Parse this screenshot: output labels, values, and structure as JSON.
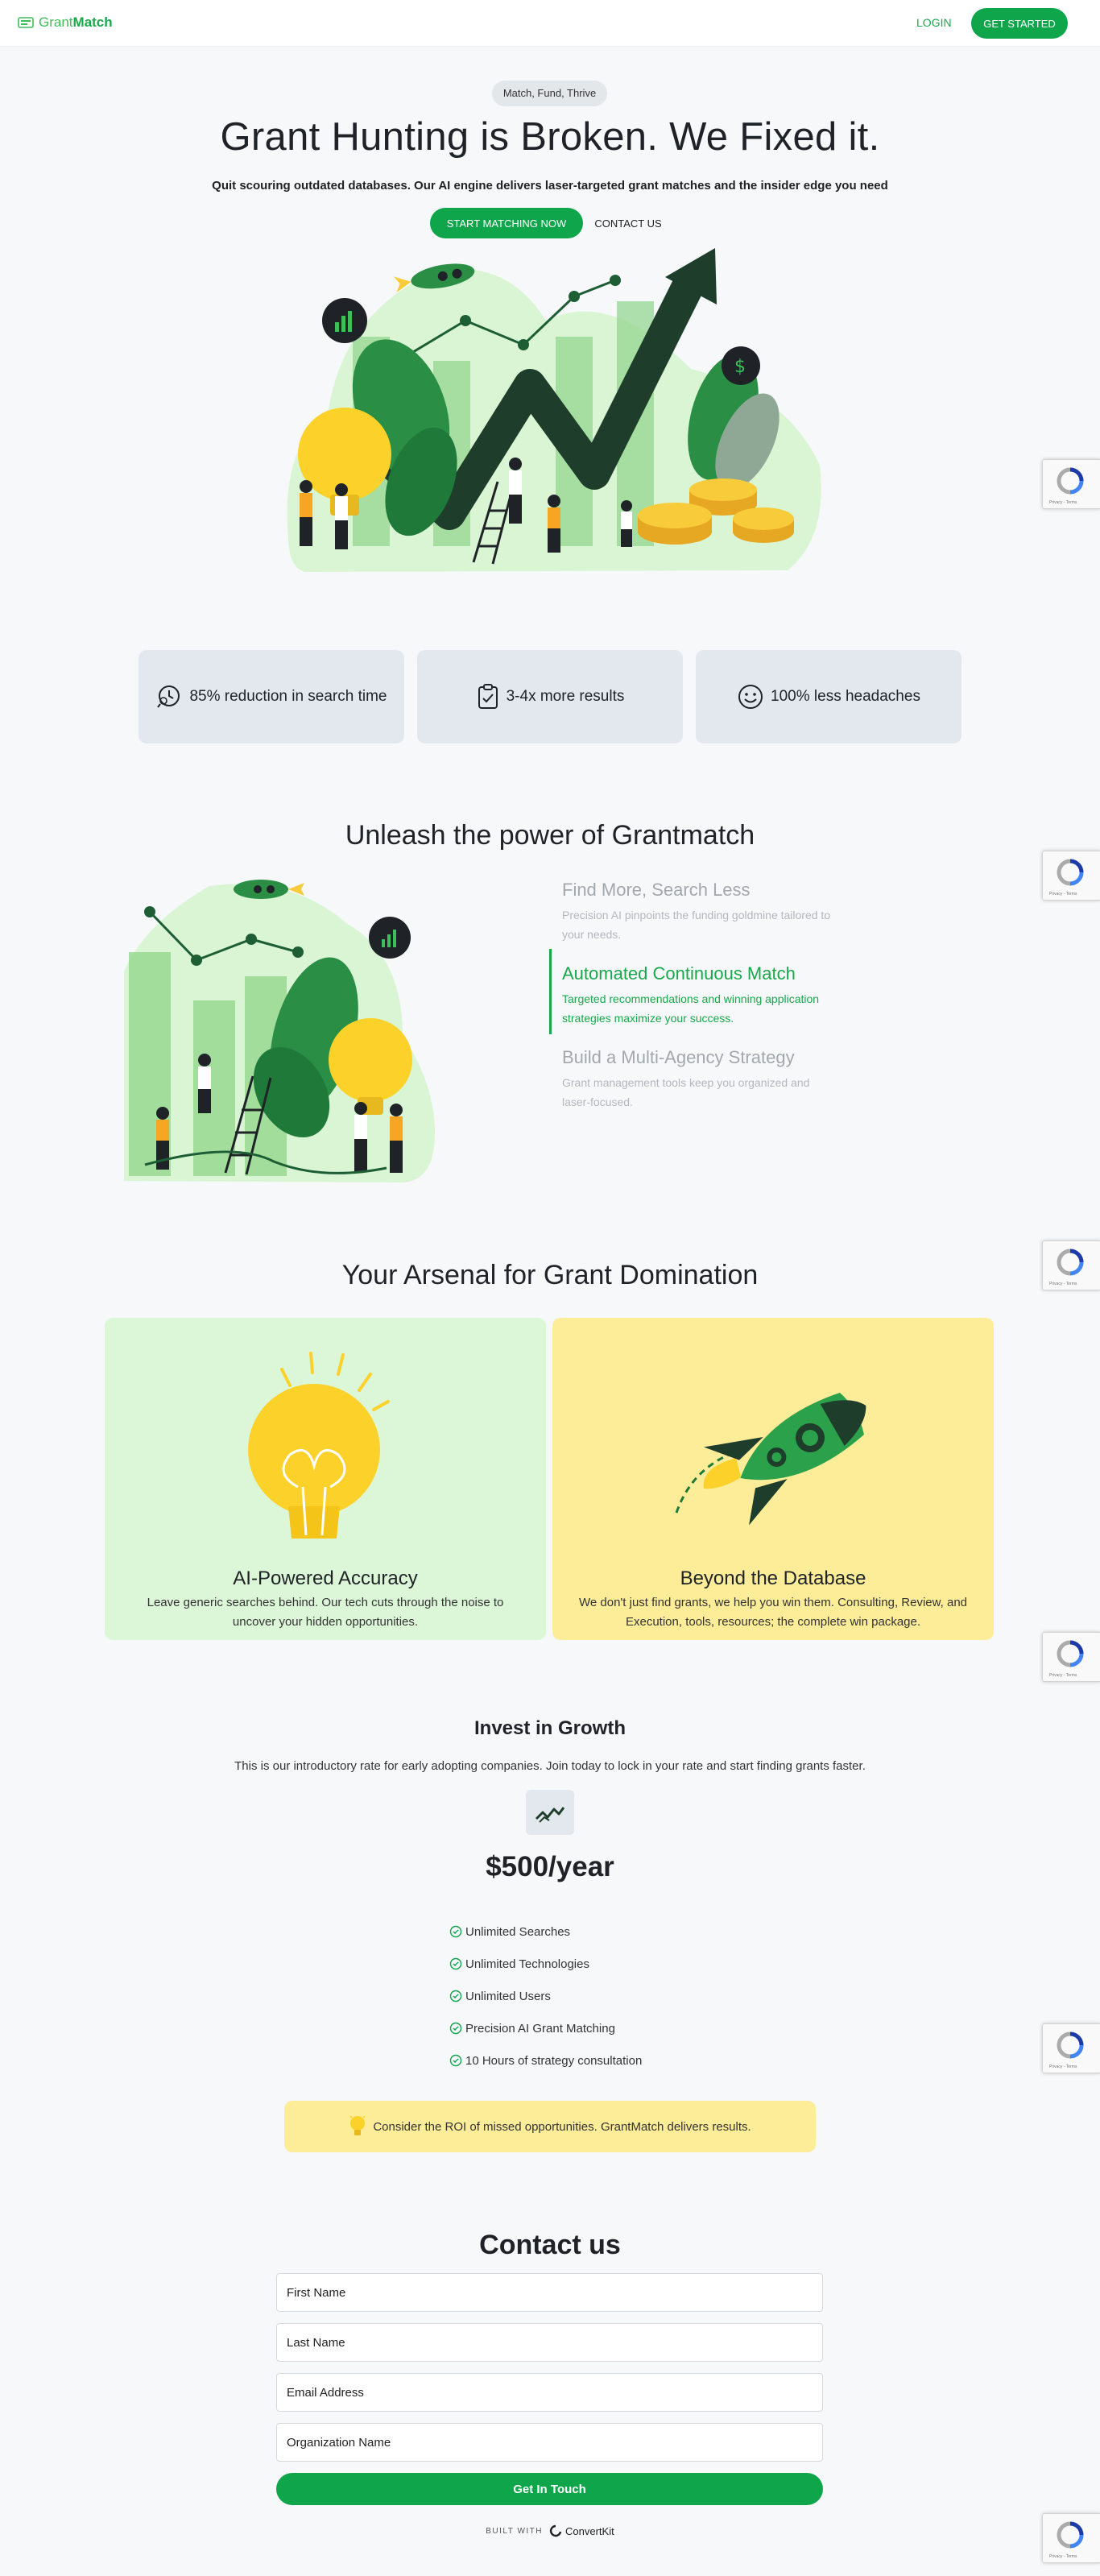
{
  "header": {
    "logo_text_light": "Grant",
    "logo_text_bold": "Match",
    "login_label": "LOGIN",
    "get_started_label": "GET STARTED"
  },
  "hero": {
    "pill": "Match, Fund, Thrive",
    "title": "Grant Hunting is Broken. We Fixed it.",
    "subtitle": "Quit scouring outdated databases. Our AI engine delivers laser-targeted grant matches and the insider edge you need",
    "primary_cta": "START MATCHING NOW",
    "secondary_cta": "CONTACT US"
  },
  "stats": [
    {
      "icon": "magnifier-clock-icon",
      "label": "85% reduction in search time"
    },
    {
      "icon": "clipboard-check-icon",
      "label": "3-4x more results"
    },
    {
      "icon": "smiley-icon",
      "label": "100% less headaches"
    }
  ],
  "features": {
    "title": "Unleash the power of Grantmatch",
    "items": [
      {
        "title": "Find More, Search Less",
        "text": "Precision AI pinpoints the funding goldmine tailored to your needs.",
        "active": false
      },
      {
        "title": "Automated Continuous Match",
        "text": "Targeted recommendations and winning application strategies maximize your success.",
        "active": true
      },
      {
        "title": "Build a Multi-Agency Strategy",
        "text": " Grant management tools keep you organized and laser-focused.",
        "active": false
      }
    ]
  },
  "arsenal": {
    "title": "Your Arsenal for Grant Domination",
    "cards": [
      {
        "icon": "lightbulb-icon",
        "title": "AI-Powered Accuracy",
        "text": "Leave generic searches behind. Our tech cuts through the noise to uncover your hidden opportunities."
      },
      {
        "icon": "rocket-icon",
        "title": "Beyond the Database",
        "text": "We don't just find grants, we help you win them. Consulting, Review, and Execution, tools, resources; the complete win package."
      }
    ]
  },
  "pricing": {
    "title": "Invest in Growth",
    "description": "This is our introductory rate for early adopting companies. Join today to lock in your rate and start finding grants faster.",
    "price": "$500/year",
    "features": [
      "Unlimited Searches",
      "Unlimited Technologies",
      "Unlimited Users",
      "Precision AI Grant Matching",
      "10 Hours of strategy consultation"
    ],
    "roi_text": "Consider the ROI of missed opportunities. GrantMatch delivers results."
  },
  "contact": {
    "title": "Contact us",
    "first_name_placeholder": "First Name",
    "last_name_placeholder": "Last Name",
    "email_placeholder": "Email Address",
    "org_placeholder": "Organization Name",
    "submit_label": "Get In Touch",
    "built_with": "BUILT WITH",
    "built_with_brand": "ConvertKit"
  },
  "recaptcha": {
    "footer": "Privacy - Terms"
  },
  "colors": {
    "brand_green": "#0fa54a",
    "light_green": "#dcf7d8",
    "yellow": "#fdec98",
    "stat_bg": "#e3e8ef"
  }
}
